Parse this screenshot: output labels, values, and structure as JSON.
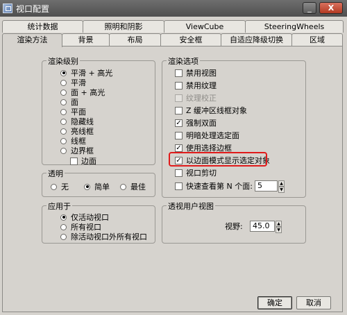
{
  "window": {
    "title": "视口配置",
    "min_label": "_",
    "close_label": "X"
  },
  "tabs_row1": [
    {
      "label": "统计数据"
    },
    {
      "label": "照明和阴影"
    },
    {
      "label": "ViewCube"
    },
    {
      "label": "SteeringWheels"
    }
  ],
  "tabs_row2": [
    {
      "label": "渲染方法"
    },
    {
      "label": "背景"
    },
    {
      "label": "布局"
    },
    {
      "label": "安全框"
    },
    {
      "label": "自适应降级切换"
    },
    {
      "label": "区域"
    }
  ],
  "render_level": {
    "title": "渲染级别",
    "options": [
      "平滑 + 高光",
      "平滑",
      "面 + 高光",
      "面",
      "平面",
      "隐藏线",
      "亮线框",
      "线框",
      "边界框"
    ],
    "selected_index": 0,
    "edge_checkbox": {
      "label": "边面",
      "checked": false
    }
  },
  "transparency": {
    "title": "透明",
    "options": [
      "无",
      "简单",
      "最佳"
    ],
    "selected_index": 1
  },
  "apply_to": {
    "title": "应用于",
    "options": [
      "仅活动视口",
      "所有视口",
      "除活动视口外所有视口"
    ],
    "selected_index": 0
  },
  "render_options": {
    "title": "渲染选项",
    "items": [
      {
        "label": "禁用视图",
        "checked": false,
        "disabled": false
      },
      {
        "label": "禁用纹理",
        "checked": false,
        "disabled": false
      },
      {
        "label": "纹理校正",
        "checked": false,
        "disabled": true
      },
      {
        "label": "Z 缓冲区线框对象",
        "checked": false,
        "disabled": false
      },
      {
        "label": "强制双面",
        "checked": true,
        "disabled": false
      },
      {
        "label": "明暗处理选定面",
        "checked": false,
        "disabled": false
      },
      {
        "label": "使用选择边框",
        "checked": true,
        "disabled": false
      },
      {
        "label": "以边面模式显示选定对象",
        "checked": true,
        "disabled": false
      },
      {
        "label": "视口剪切",
        "checked": false,
        "disabled": false
      },
      {
        "label": "快速查看第 N 个面:",
        "checked": false,
        "disabled": false
      }
    ],
    "nth_face_value": "5",
    "check_mark": "✓"
  },
  "perspective": {
    "title": "透视用户视图",
    "fov_label": "视野:",
    "fov_value": "45.0"
  },
  "spin": {
    "up": "▲",
    "down": "▼"
  },
  "buttons": {
    "ok": "确定",
    "cancel": "取消"
  }
}
